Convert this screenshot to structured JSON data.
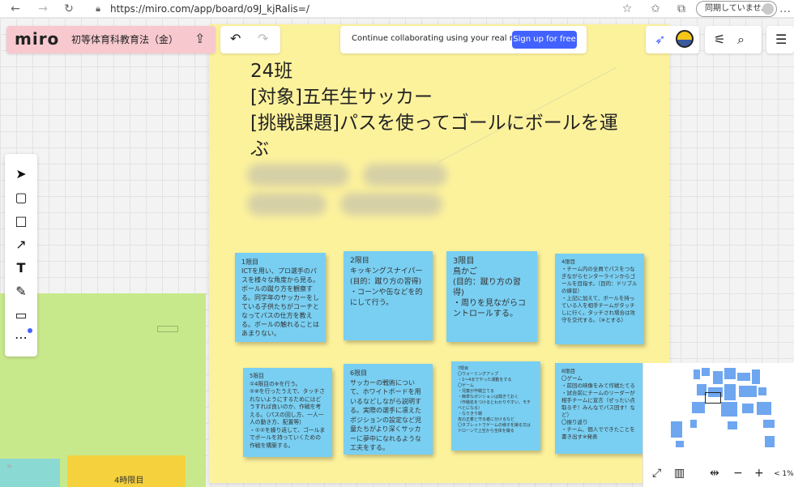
{
  "browser": {
    "url": "https://miro.com/app/board/o9J_kjRalis=/",
    "sync_label": "同期していません"
  },
  "header": {
    "logo": "miro",
    "board_name": "初等体育科教育法（金）",
    "banner_text": "Continue collaborating using your real name.",
    "signup_label": "Sign up for free"
  },
  "main_note": {
    "title": "24班\n[対象]五年生サッカー\n[挑戦課題]パスを使ってゴールにボールを運ぶ"
  },
  "stickies": [
    {
      "text": "1限目\nICTを用い、プロ選手のパスを様々な角度から見る。ボールの蹴り方を観察する。同学年のサッカーをしている子供たちがコーチとなってパスの仕方を教える。ボールの触れることはあまりない。"
    },
    {
      "text": "2限目\nキッキングスナイパー\n(目的：蹴り方の習得)\n・コーンや缶などを的にして行う。"
    },
    {
      "text": "3限目\n鳥かご\n(目的：蹴り方の習得)\n・周りを見ながらコントロールする。"
    },
    {
      "text": "4限目\n・チーム内の全員でパスをつなぎながらセンターラインからゴールを目指す。（目的：ドリブルの練習）\n・上記に加えて、ボールを持っている人を相手チームがタッチしに行く。タッチされ場合は攻守を交代する。（※とする）"
    },
    {
      "text": "5限目\n①4限目の※を行う。\n②※を行ったうえで、タッチされないようにするためにはどうすれば良いのか、作戦を考える。（パスの回し方、一人一人の動き方、配置等）\n・①②を繰り返して、ゴールまでボールを持っていくための作戦を構築する。"
    },
    {
      "text": "6限目\nサッカーの戦術について、ホワイトボードを用いるなどしながら説明する。実際の選手に凛えたポジションの設定など児童たちがより深くサッカーに夢中になれるような工夫をする。"
    },
    {
      "text": "7限目\n〇ウォーミングアップ\n・1～4までやった運動をする\n〇ゲーム\n・児童が作戦立てる\n・簡単なポジションは聞きておく\n（作戦名をつけるとわかりやすい、モチベとになる）\n・なりきり戦\n攻の正着と守る者に分けるなど\n〇タブレットでゲームの様子を撮る又はドローンで上空から全体を撮る"
    },
    {
      "text": "8限目\n〇ゲーム\n・前回の映像をみて作戦たてる\n・試合前にチームのリーダーが相手チームに宣言（ぜったい点取るぞ！みんなでパス回す！など）\n〇振り返り\n・チーム、個人でできたことを書き出す※発表"
    }
  ],
  "left_board": {
    "period_label": "4時限目"
  },
  "zoom": {
    "level": "< 1%"
  },
  "colors": {
    "main_note": "#fdf29c",
    "sticky": "#79cff2",
    "accent": "#4262ff",
    "board_pill": "#f7c9cf",
    "green_note": "#c8e98b"
  }
}
